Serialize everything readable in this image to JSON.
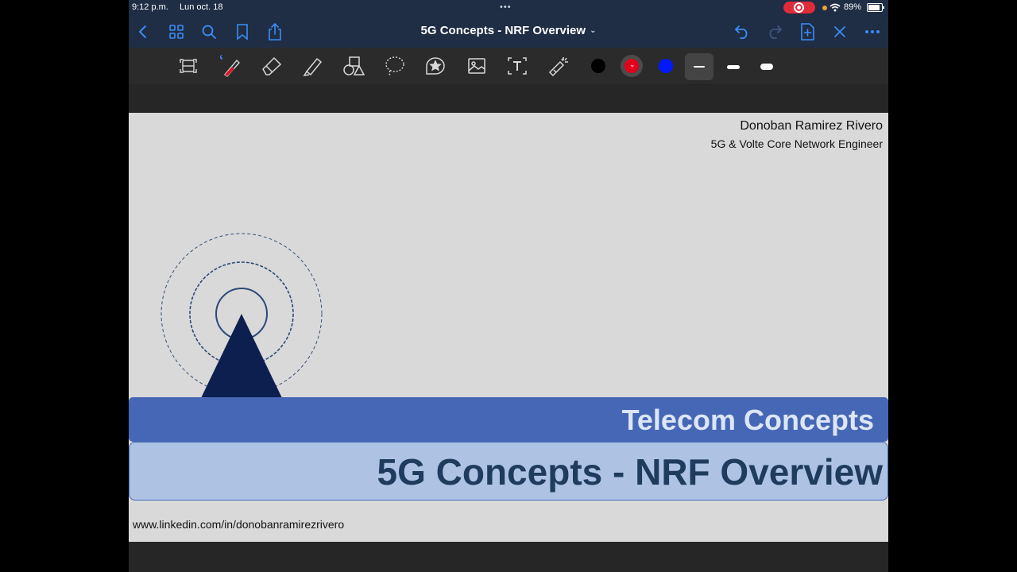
{
  "status_bar": {
    "time": "9:12 p.m.",
    "date": "Lun oct. 18",
    "dots": "•••",
    "battery": "89%",
    "battery_level": 0.89,
    "record_color": "#e02c3a"
  },
  "navbar": {
    "title": "5G Concepts - NRF Overview",
    "chevron": "⌄",
    "accent_color": "#3a8ef6",
    "left_icons": [
      "back-icon",
      "grid-icon",
      "search-icon",
      "bookmark-icon",
      "share-icon"
    ],
    "right_icons": [
      "undo-icon",
      "redo-icon",
      "add-page-icon",
      "close-icon",
      "more-icon"
    ]
  },
  "toolbar": {
    "tools": [
      "scan-icon",
      "pen-icon",
      "eraser-icon",
      "highlighter-icon",
      "shapes-icon",
      "lasso-icon",
      "sticker-icon",
      "image-icon",
      "text-icon",
      "laser-pointer-icon"
    ],
    "colors": [
      "#000000",
      "#e4001b",
      "#0019ff"
    ],
    "selected_color": "#e4001b",
    "selected_stroke": "thin"
  },
  "slide": {
    "author_name": "Donoban Ramirez Rivero",
    "author_role": "5G & Volte Core Network Engineer",
    "category": "Telecom Concepts",
    "title": "5G Concepts - NRF Overview",
    "link": "www.linkedin.com/in/donobanramirezrivero",
    "colors": {
      "band_top": "#4567b6",
      "band_bottom": "#aec3e4",
      "tower": "#0d1f4f"
    }
  }
}
